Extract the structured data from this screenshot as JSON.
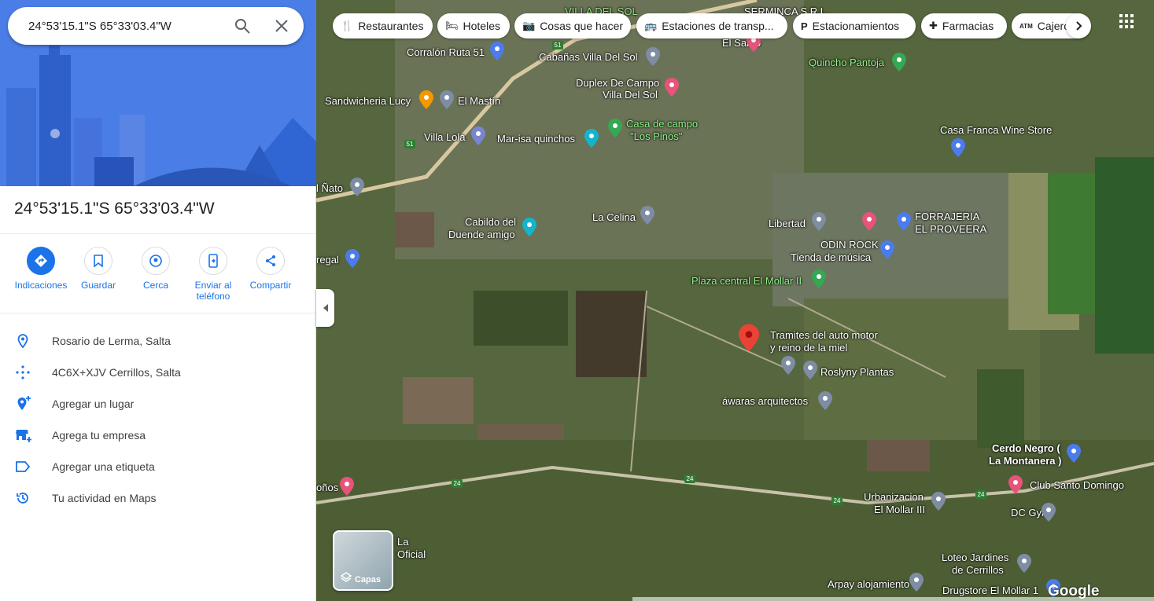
{
  "search": {
    "value": "24°53'15.1\"S 65°33'03.4\"W"
  },
  "place": {
    "title": "24°53'15.1\"S 65°33'03.4\"W"
  },
  "actions": [
    {
      "label": "Indicaciones",
      "icon": "directions-icon"
    },
    {
      "label": "Guardar",
      "icon": "bookmark-icon"
    },
    {
      "label": "Cerca",
      "icon": "nearby-icon"
    },
    {
      "label": "Enviar al teléfono",
      "icon": "send-to-phone-icon"
    },
    {
      "label": "Compartir",
      "icon": "share-icon"
    }
  ],
  "info": [
    {
      "text": "Rosario de Lerma, Salta",
      "icon": "location-pin-icon"
    },
    {
      "text": "4C6X+XJV Cerrillos, Salta",
      "icon": "plus-code-icon"
    },
    {
      "text": "Agregar un lugar",
      "icon": "add-place-icon"
    },
    {
      "text": "Agrega tu empresa",
      "icon": "add-business-icon"
    },
    {
      "text": "Agregar una etiqueta",
      "icon": "label-icon"
    },
    {
      "text": "Tu actividad en Maps",
      "icon": "history-icon"
    }
  ],
  "chips": [
    {
      "label": "Restaurantes",
      "icon": "🍴"
    },
    {
      "label": "Hoteles",
      "icon": "🛏"
    },
    {
      "label": "Cosas que hacer",
      "icon": "📷"
    },
    {
      "label": "Estaciones de transp...",
      "icon": "🚌"
    },
    {
      "label": "Estacionamientos",
      "icon": "P"
    },
    {
      "label": "Farmacias",
      "icon": "✚"
    },
    {
      "label": "Cajero",
      "icon": "ATM"
    }
  ],
  "map_labels": {
    "villa_del_sol": "VILLA DEL SOL",
    "serminca": "SERMINCA S.R.L.",
    "el_sarito": "El Sarito",
    "corralon": "Corralón Ruta 51",
    "cabanas": "Cabañas Villa Del Sol",
    "quincho": "Quincho Pantoja",
    "duplex1": "Duplex De Campo",
    "duplex2": "Villa Del Sol",
    "sandwicheria": "Sandwicheria Lucy",
    "el_mastin": "El Mastín",
    "casa_campo1": "Casa de campo",
    "casa_campo2": "\"Los Pinos\"",
    "casa_franca": "Casa Franca Wine Store",
    "villa_lola": "Villa Lola",
    "marisa": "Mar-isa quinchos",
    "nato": "l Ñato",
    "cabildo1": "Cabildo del",
    "cabildo2": "Duende amigo",
    "la_celina": "La Celina",
    "libertad": "Libertad",
    "forrajeria1": "FORRAJERIA",
    "forrajeria2": "EL PROVEERA",
    "odin1": "ODIN ROCK",
    "odin2": "Tienda de música",
    "regal": "regal",
    "plaza": "Plaza central El Mollar II",
    "tramites1": "Tramites del auto motor",
    "tramites2": "y reino de la miel",
    "roslyny": "Roslyny Plantas",
    "awaras": "áwaras arquitectos",
    "cerdo1": "Cerdo Negro (",
    "cerdo2": "La Montanera )",
    "club": "Club Santo Domingo",
    "urbanizacion1": "Urbanizacion",
    "urbanizacion2": "El Mollar III",
    "dc_gym": "DC Gym",
    "onos": "oños",
    "la_oficial1": "La",
    "la_oficial2": "Oficial",
    "loteo1": "Loteo Jardines",
    "loteo2": "de Cerrillos",
    "arpay": "Arpay alojamiento",
    "drugstore": "Drugstore El Mollar 1",
    "route_51": "51",
    "route_24": "24"
  },
  "layers_label": "Capas",
  "google_logo": "Google"
}
